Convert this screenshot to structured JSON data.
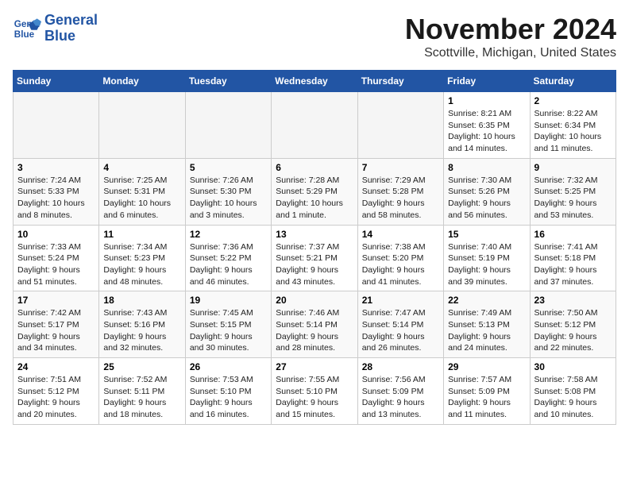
{
  "header": {
    "logo_line1": "General",
    "logo_line2": "Blue",
    "month": "November 2024",
    "location": "Scottville, Michigan, United States"
  },
  "weekdays": [
    "Sunday",
    "Monday",
    "Tuesday",
    "Wednesday",
    "Thursday",
    "Friday",
    "Saturday"
  ],
  "weeks": [
    [
      {
        "day": "",
        "info": ""
      },
      {
        "day": "",
        "info": ""
      },
      {
        "day": "",
        "info": ""
      },
      {
        "day": "",
        "info": ""
      },
      {
        "day": "",
        "info": ""
      },
      {
        "day": "1",
        "info": "Sunrise: 8:21 AM\nSunset: 6:35 PM\nDaylight: 10 hours and 14 minutes."
      },
      {
        "day": "2",
        "info": "Sunrise: 8:22 AM\nSunset: 6:34 PM\nDaylight: 10 hours and 11 minutes."
      }
    ],
    [
      {
        "day": "3",
        "info": "Sunrise: 7:24 AM\nSunset: 5:33 PM\nDaylight: 10 hours and 8 minutes."
      },
      {
        "day": "4",
        "info": "Sunrise: 7:25 AM\nSunset: 5:31 PM\nDaylight: 10 hours and 6 minutes."
      },
      {
        "day": "5",
        "info": "Sunrise: 7:26 AM\nSunset: 5:30 PM\nDaylight: 10 hours and 3 minutes."
      },
      {
        "day": "6",
        "info": "Sunrise: 7:28 AM\nSunset: 5:29 PM\nDaylight: 10 hours and 1 minute."
      },
      {
        "day": "7",
        "info": "Sunrise: 7:29 AM\nSunset: 5:28 PM\nDaylight: 9 hours and 58 minutes."
      },
      {
        "day": "8",
        "info": "Sunrise: 7:30 AM\nSunset: 5:26 PM\nDaylight: 9 hours and 56 minutes."
      },
      {
        "day": "9",
        "info": "Sunrise: 7:32 AM\nSunset: 5:25 PM\nDaylight: 9 hours and 53 minutes."
      }
    ],
    [
      {
        "day": "10",
        "info": "Sunrise: 7:33 AM\nSunset: 5:24 PM\nDaylight: 9 hours and 51 minutes."
      },
      {
        "day": "11",
        "info": "Sunrise: 7:34 AM\nSunset: 5:23 PM\nDaylight: 9 hours and 48 minutes."
      },
      {
        "day": "12",
        "info": "Sunrise: 7:36 AM\nSunset: 5:22 PM\nDaylight: 9 hours and 46 minutes."
      },
      {
        "day": "13",
        "info": "Sunrise: 7:37 AM\nSunset: 5:21 PM\nDaylight: 9 hours and 43 minutes."
      },
      {
        "day": "14",
        "info": "Sunrise: 7:38 AM\nSunset: 5:20 PM\nDaylight: 9 hours and 41 minutes."
      },
      {
        "day": "15",
        "info": "Sunrise: 7:40 AM\nSunset: 5:19 PM\nDaylight: 9 hours and 39 minutes."
      },
      {
        "day": "16",
        "info": "Sunrise: 7:41 AM\nSunset: 5:18 PM\nDaylight: 9 hours and 37 minutes."
      }
    ],
    [
      {
        "day": "17",
        "info": "Sunrise: 7:42 AM\nSunset: 5:17 PM\nDaylight: 9 hours and 34 minutes."
      },
      {
        "day": "18",
        "info": "Sunrise: 7:43 AM\nSunset: 5:16 PM\nDaylight: 9 hours and 32 minutes."
      },
      {
        "day": "19",
        "info": "Sunrise: 7:45 AM\nSunset: 5:15 PM\nDaylight: 9 hours and 30 minutes."
      },
      {
        "day": "20",
        "info": "Sunrise: 7:46 AM\nSunset: 5:14 PM\nDaylight: 9 hours and 28 minutes."
      },
      {
        "day": "21",
        "info": "Sunrise: 7:47 AM\nSunset: 5:14 PM\nDaylight: 9 hours and 26 minutes."
      },
      {
        "day": "22",
        "info": "Sunrise: 7:49 AM\nSunset: 5:13 PM\nDaylight: 9 hours and 24 minutes."
      },
      {
        "day": "23",
        "info": "Sunrise: 7:50 AM\nSunset: 5:12 PM\nDaylight: 9 hours and 22 minutes."
      }
    ],
    [
      {
        "day": "24",
        "info": "Sunrise: 7:51 AM\nSunset: 5:12 PM\nDaylight: 9 hours and 20 minutes."
      },
      {
        "day": "25",
        "info": "Sunrise: 7:52 AM\nSunset: 5:11 PM\nDaylight: 9 hours and 18 minutes."
      },
      {
        "day": "26",
        "info": "Sunrise: 7:53 AM\nSunset: 5:10 PM\nDaylight: 9 hours and 16 minutes."
      },
      {
        "day": "27",
        "info": "Sunrise: 7:55 AM\nSunset: 5:10 PM\nDaylight: 9 hours and 15 minutes."
      },
      {
        "day": "28",
        "info": "Sunrise: 7:56 AM\nSunset: 5:09 PM\nDaylight: 9 hours and 13 minutes."
      },
      {
        "day": "29",
        "info": "Sunrise: 7:57 AM\nSunset: 5:09 PM\nDaylight: 9 hours and 11 minutes."
      },
      {
        "day": "30",
        "info": "Sunrise: 7:58 AM\nSunset: 5:08 PM\nDaylight: 9 hours and 10 minutes."
      }
    ]
  ]
}
